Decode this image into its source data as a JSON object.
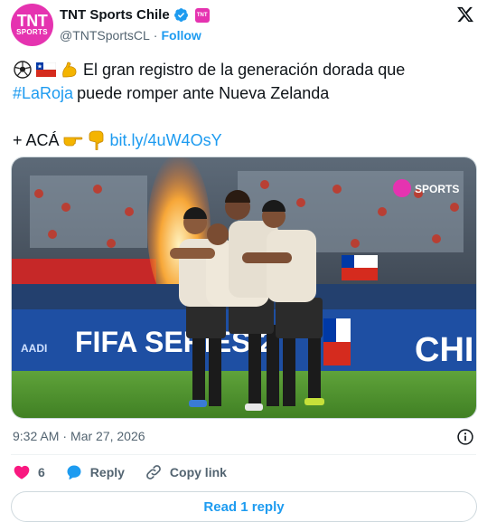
{
  "account": {
    "display_name": "TNT Sports Chile",
    "handle": "@TNTSportsCL",
    "separator": "·",
    "follow_label": "Follow",
    "avatar_line1": "TNT",
    "avatar_line2": "SPORTS",
    "verified_icon": "verified-badge-icon",
    "affiliate_icon": "tnt-affiliate-badge-icon",
    "brand_color": "#e533b0",
    "verified_color": "#1d9bf0"
  },
  "tweet": {
    "line1_text": "El gran registro de la generación dorada que",
    "hashtag": "#LaRoja",
    "line2_text": "puede romper ante Nueva Zelanda",
    "line3_prefix": "+ ACÁ",
    "link": "bit.ly/4uW4OsY",
    "emojis": [
      "soccer-ball-icon",
      "chile-flag-icon",
      "flexed-biceps-icon",
      "backhand-right-icon",
      "backhand-down-icon"
    ]
  },
  "photo": {
    "watermark": "SPORTS",
    "banner_left": "FIFA SERIES 2",
    "banner_right": "CHILE",
    "board_small": "AADI"
  },
  "meta": {
    "time": "9:32 AM",
    "separator": "·",
    "date": "Mar 27, 2026"
  },
  "actions": {
    "like_count": "6",
    "reply_label": "Reply",
    "copy_link_label": "Copy link",
    "read_reply_label": "Read 1 reply"
  },
  "colors": {
    "link": "#1d9bf0",
    "like": "#f91880",
    "text_secondary": "#536471"
  }
}
